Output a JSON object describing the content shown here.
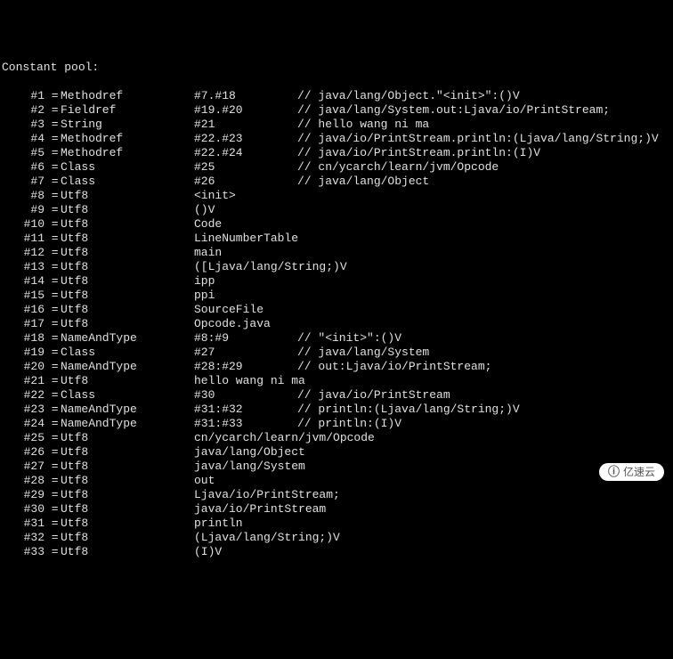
{
  "header": "Constant pool:",
  "entries": [
    {
      "idx": "#1",
      "tag": "Methodref",
      "ref": "#7.#18",
      "comment": "// java/lang/Object.\"<init>\":()V"
    },
    {
      "idx": "#2",
      "tag": "Fieldref",
      "ref": "#19.#20",
      "comment": "// java/lang/System.out:Ljava/io/PrintStream;"
    },
    {
      "idx": "#3",
      "tag": "String",
      "ref": "#21",
      "comment": "// hello wang ni ma"
    },
    {
      "idx": "#4",
      "tag": "Methodref",
      "ref": "#22.#23",
      "comment": "// java/io/PrintStream.println:(Ljava/lang/String;)V"
    },
    {
      "idx": "#5",
      "tag": "Methodref",
      "ref": "#22.#24",
      "comment": "// java/io/PrintStream.println:(I)V"
    },
    {
      "idx": "#6",
      "tag": "Class",
      "ref": "#25",
      "comment": "// cn/ycarch/learn/jvm/Opcode"
    },
    {
      "idx": "#7",
      "tag": "Class",
      "ref": "#26",
      "comment": "// java/lang/Object"
    },
    {
      "idx": "#8",
      "tag": "Utf8",
      "ref": "<init>",
      "comment": ""
    },
    {
      "idx": "#9",
      "tag": "Utf8",
      "ref": "()V",
      "comment": ""
    },
    {
      "idx": "#10",
      "tag": "Utf8",
      "ref": "Code",
      "comment": ""
    },
    {
      "idx": "#11",
      "tag": "Utf8",
      "ref": "LineNumberTable",
      "comment": ""
    },
    {
      "idx": "#12",
      "tag": "Utf8",
      "ref": "main",
      "comment": ""
    },
    {
      "idx": "#13",
      "tag": "Utf8",
      "ref": "([Ljava/lang/String;)V",
      "comment": ""
    },
    {
      "idx": "#14",
      "tag": "Utf8",
      "ref": "ipp",
      "comment": ""
    },
    {
      "idx": "#15",
      "tag": "Utf8",
      "ref": "ppi",
      "comment": ""
    },
    {
      "idx": "#16",
      "tag": "Utf8",
      "ref": "SourceFile",
      "comment": ""
    },
    {
      "idx": "#17",
      "tag": "Utf8",
      "ref": "Opcode.java",
      "comment": ""
    },
    {
      "idx": "#18",
      "tag": "NameAndType",
      "ref": "#8:#9",
      "comment": "// \"<init>\":()V"
    },
    {
      "idx": "#19",
      "tag": "Class",
      "ref": "#27",
      "comment": "// java/lang/System"
    },
    {
      "idx": "#20",
      "tag": "NameAndType",
      "ref": "#28:#29",
      "comment": "// out:Ljava/io/PrintStream;"
    },
    {
      "idx": "#21",
      "tag": "Utf8",
      "ref": "hello wang ni ma",
      "comment": ""
    },
    {
      "idx": "#22",
      "tag": "Class",
      "ref": "#30",
      "comment": "// java/io/PrintStream"
    },
    {
      "idx": "#23",
      "tag": "NameAndType",
      "ref": "#31:#32",
      "comment": "// println:(Ljava/lang/String;)V"
    },
    {
      "idx": "#24",
      "tag": "NameAndType",
      "ref": "#31:#33",
      "comment": "// println:(I)V"
    },
    {
      "idx": "#25",
      "tag": "Utf8",
      "ref": "cn/ycarch/learn/jvm/Opcode",
      "comment": ""
    },
    {
      "idx": "#26",
      "tag": "Utf8",
      "ref": "java/lang/Object",
      "comment": ""
    },
    {
      "idx": "#27",
      "tag": "Utf8",
      "ref": "java/lang/System",
      "comment": ""
    },
    {
      "idx": "#28",
      "tag": "Utf8",
      "ref": "out",
      "comment": ""
    },
    {
      "idx": "#29",
      "tag": "Utf8",
      "ref": "Ljava/io/PrintStream;",
      "comment": ""
    },
    {
      "idx": "#30",
      "tag": "Utf8",
      "ref": "java/io/PrintStream",
      "comment": ""
    },
    {
      "idx": "#31",
      "tag": "Utf8",
      "ref": "println",
      "comment": ""
    },
    {
      "idx": "#32",
      "tag": "Utf8",
      "ref": "(Ljava/lang/String;)V",
      "comment": ""
    },
    {
      "idx": "#33",
      "tag": "Utf8",
      "ref": "(I)V",
      "comment": ""
    }
  ],
  "watermark": "亿速云"
}
